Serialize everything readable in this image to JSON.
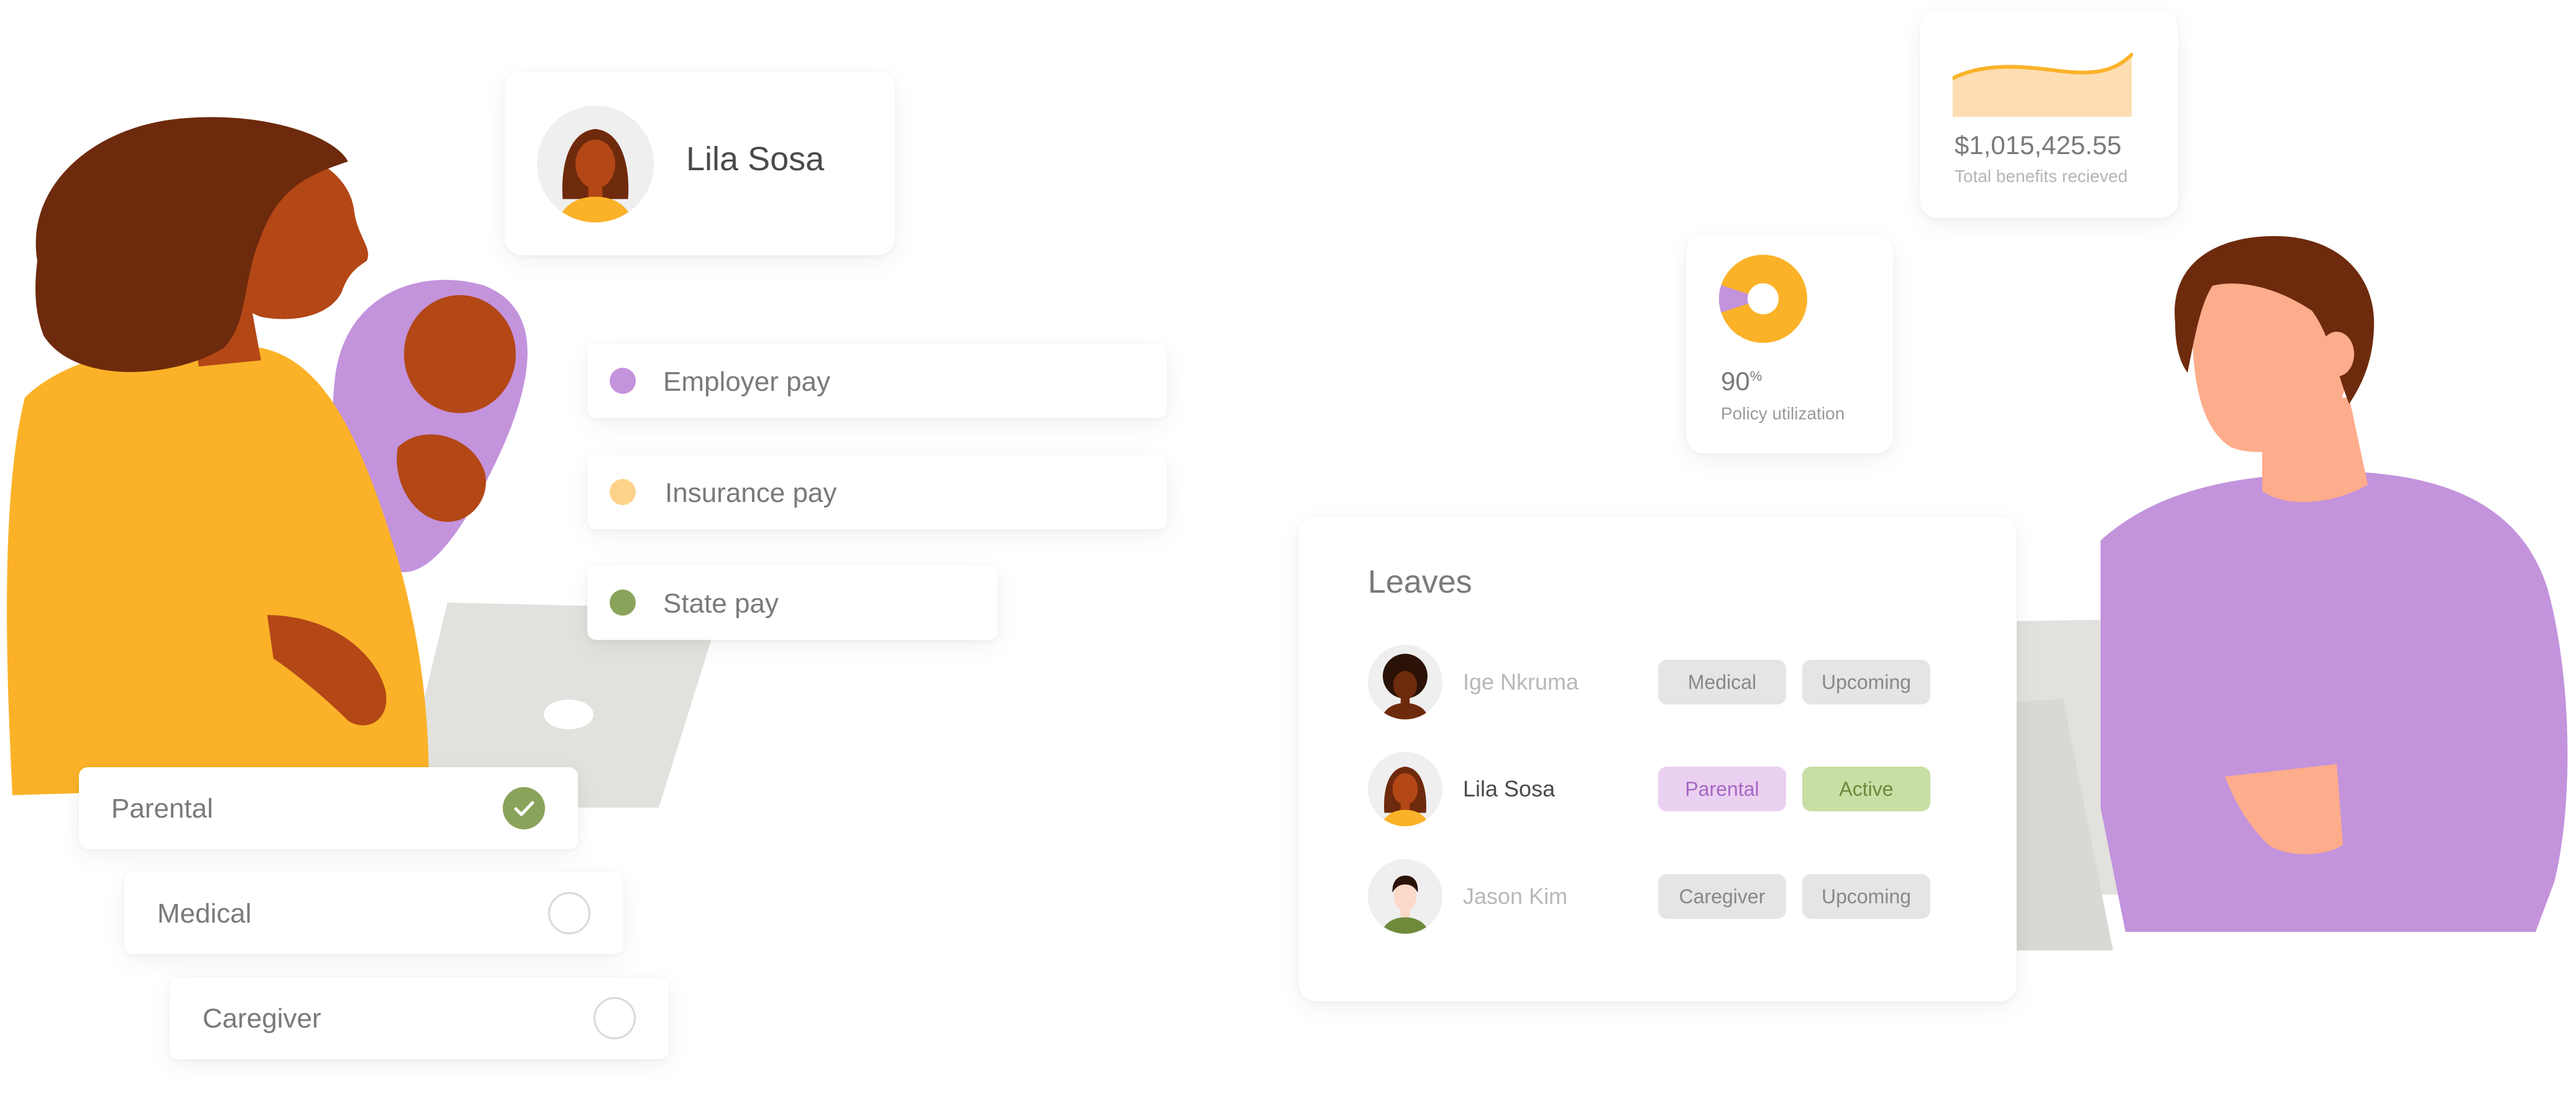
{
  "colors": {
    "yellow": "#FBB228",
    "purple": "#C393DC",
    "green": "#8AA35A",
    "skin_dark": "#B34716",
    "hair": "#6E2A0C",
    "peach": "#FDAC8C",
    "laptop": "#E2E1DE",
    "pill_gray": "#E5E5E3",
    "pill_purple": "#EBD1F1",
    "pill_green": "#C9DEA5"
  },
  "profile": {
    "name": "Lila Sosa"
  },
  "pay_types": [
    {
      "label": "Employer pay",
      "color": "#C393DC"
    },
    {
      "label": "Insurance pay",
      "color": "#FDD38C"
    },
    {
      "label": "State pay",
      "color": "#8AA35A"
    }
  ],
  "leave_types": [
    {
      "label": "Parental",
      "checked": true
    },
    {
      "label": "Medical",
      "checked": false
    },
    {
      "label": "Caregiver",
      "checked": false
    }
  ],
  "benefits": {
    "amount": "$1,015,425.55",
    "caption": "Total benefits recieved"
  },
  "utilization": {
    "value": "90",
    "unit": "%",
    "caption": "Policy utilization",
    "fraction": 0.9
  },
  "leaves": {
    "title": "Leaves",
    "rows": [
      {
        "name": "Ige Nkruma",
        "type": "Medical",
        "status": "Upcoming",
        "active": false,
        "avatar": "woman-dark-icon"
      },
      {
        "name": "Lila Sosa",
        "type": "Parental",
        "status": "Active",
        "active": true,
        "avatar": "woman-brown-icon"
      },
      {
        "name": "Jason Kim",
        "type": "Caregiver",
        "status": "Upcoming",
        "active": false,
        "avatar": "man-icon"
      }
    ]
  }
}
